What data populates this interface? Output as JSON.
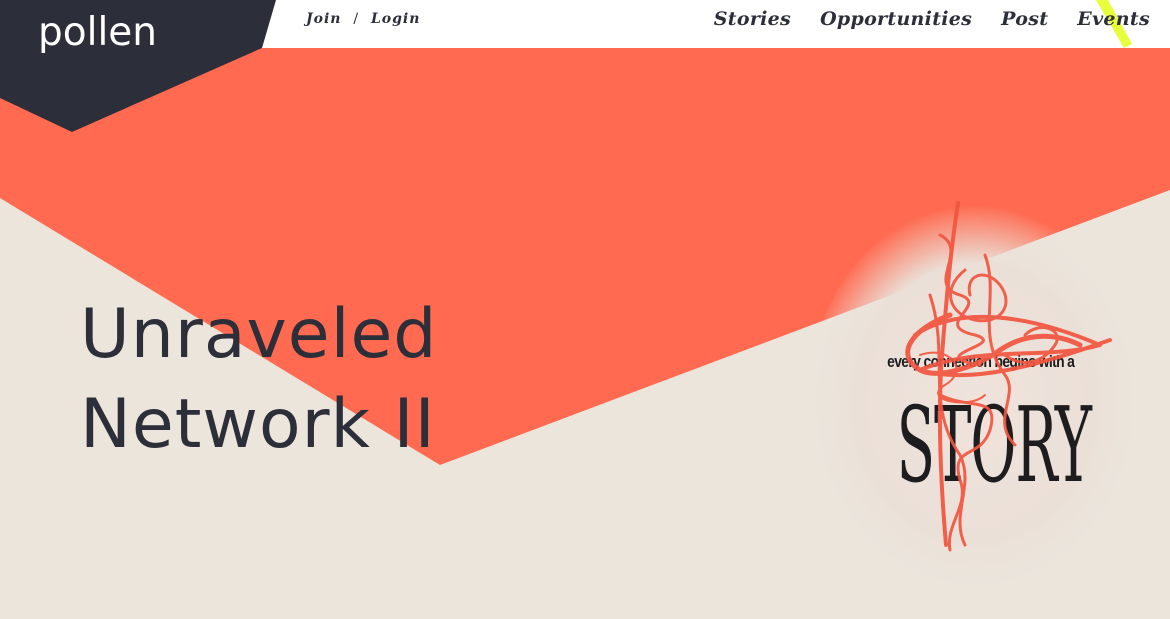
{
  "brand": {
    "logo_text": "pollen"
  },
  "header": {
    "auth": {
      "join_label": "Join",
      "separator": "/",
      "login_label": "Login"
    },
    "nav": [
      {
        "label": "Stories"
      },
      {
        "label": "Opportunities"
      },
      {
        "label": "Post"
      },
      {
        "label": "Events"
      }
    ]
  },
  "hero": {
    "title_line1": "Unraveled",
    "title_line2": "Network II",
    "artwork": {
      "tagline": "every connection begins with a",
      "word": "STORY"
    }
  },
  "colors": {
    "navy": "#2c2e3a",
    "coral": "#ff6a50",
    "cream": "#ebe5dc",
    "white": "#ffffff",
    "lime_accent": "#e6ff3a",
    "ink": "#1d1c1e"
  }
}
